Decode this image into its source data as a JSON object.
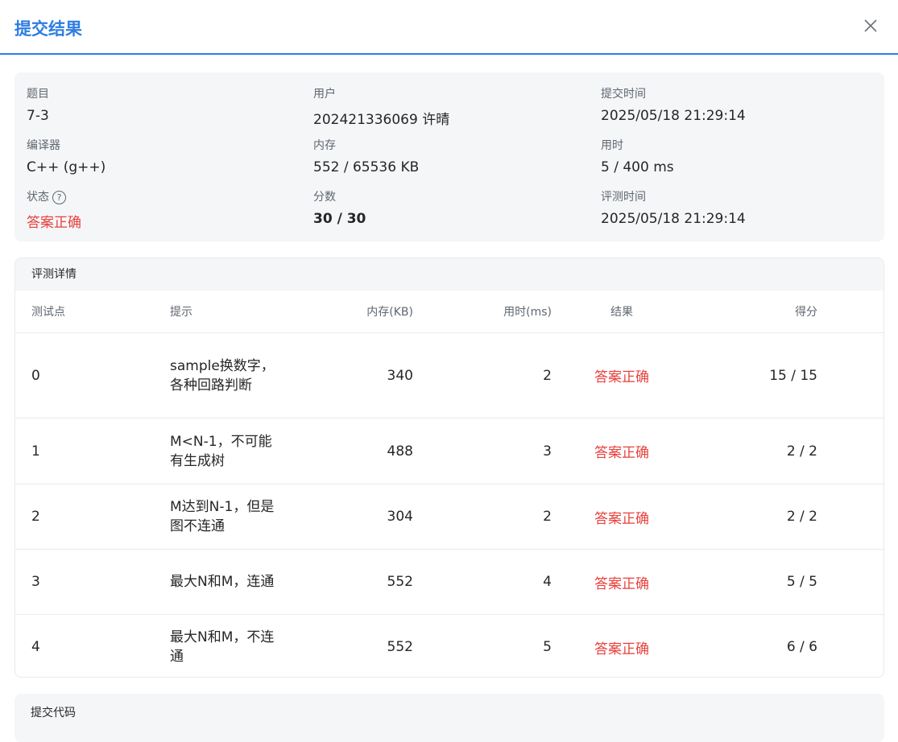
{
  "dialog": {
    "title": "提交结果"
  },
  "info": {
    "problem": {
      "label": "题目",
      "value": "7-3"
    },
    "user": {
      "label": "用户",
      "value": "202421336069 许晴"
    },
    "submit_time": {
      "label": "提交时间",
      "value": "2025/05/18 21:29:14"
    },
    "compiler": {
      "label": "编译器",
      "value": "C++ (g++)"
    },
    "memory": {
      "label": "内存",
      "value": "552 / 65536 KB"
    },
    "time_used": {
      "label": "用时",
      "value": "5 / 400 ms"
    },
    "status": {
      "label": "状态",
      "value": "答案正确",
      "help_icon": "?"
    },
    "score": {
      "label": "分数",
      "value": "30 / 30"
    },
    "judge_time": {
      "label": "评测时间",
      "value": "2025/05/18 21:29:14"
    }
  },
  "judge": {
    "title": "评测详情",
    "columns": [
      "测试点",
      "提示",
      "内存(KB)",
      "用时(ms)",
      "结果",
      "得分"
    ],
    "rows": [
      {
        "id": "0",
        "hint": "sample换数字，各种回路判断",
        "memory": "340",
        "time": "2",
        "result": "答案正确",
        "score": "15 / 15"
      },
      {
        "id": "1",
        "hint": "M<N-1，不可能有生成树",
        "memory": "488",
        "time": "3",
        "result": "答案正确",
        "score": "2 / 2"
      },
      {
        "id": "2",
        "hint": "M达到N-1，但是图不连通",
        "memory": "304",
        "time": "2",
        "result": "答案正确",
        "score": "2 / 2"
      },
      {
        "id": "3",
        "hint": "最大N和M，连通",
        "memory": "552",
        "time": "4",
        "result": "答案正确",
        "score": "5 / 5"
      },
      {
        "id": "4",
        "hint": "最大N和M，不连通",
        "memory": "552",
        "time": "5",
        "result": "答案正确",
        "score": "6 / 6"
      }
    ]
  },
  "code": {
    "title": "提交代码"
  },
  "colors": {
    "accent": "#2f7de1",
    "accepted": "#e8413c"
  },
  "icons": {
    "close": "close-icon",
    "help": "help-icon"
  }
}
